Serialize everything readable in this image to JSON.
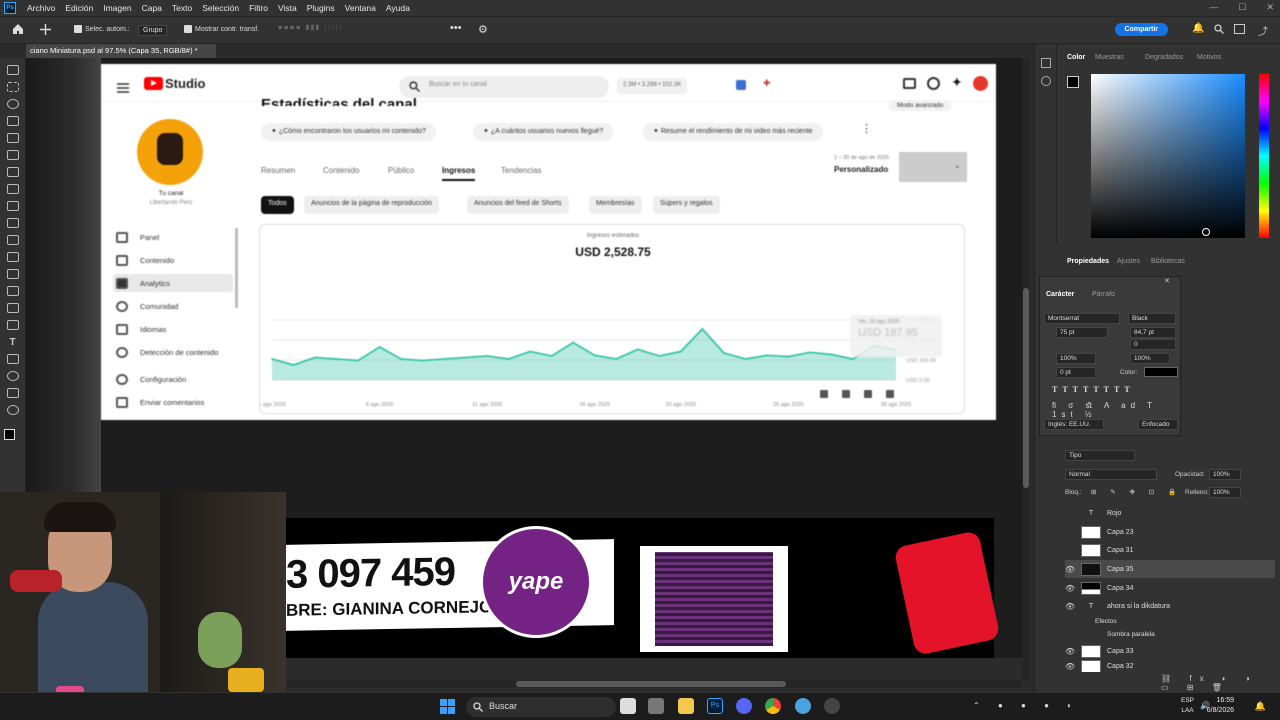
{
  "menu": [
    "Archivo",
    "Edición",
    "Imagen",
    "Capa",
    "Texto",
    "Selección",
    "Filtro",
    "Vista",
    "Plugins",
    "Ventana",
    "Ayuda"
  ],
  "options": {
    "auto_select": "Selec. autom.:",
    "group": "Grupo",
    "show_transform": "Mostrar contr. transf.",
    "share": "Compartir"
  },
  "document_tab": "ciano Miniatura.psd al 97.5% (Capa 35, RGB/8#) *",
  "yt": {
    "logo": "Studio",
    "search_placeholder": "Buscar en tu canal",
    "header_stats": "2.3M • 3.268 • 102.3K",
    "page_title": "Estadísticas del canal",
    "advanced_mode": "Modo avanzado",
    "channel_name": "Tu canal",
    "channel_handle": "Libertando Perú",
    "questions": [
      "¿Cómo encontraron los usuarios mi contenido?",
      "¿A cuántos usuarios nuevos llegué?",
      "Resume el rendimiento de mi video más reciente"
    ],
    "sidebar": [
      "Panel",
      "Contenido",
      "Analytics",
      "Comunidad",
      "Idiomas",
      "Detección de contenido",
      "Configuración",
      "Enviar comentarios"
    ],
    "tabs": [
      "Resumen",
      "Contenido",
      "Público",
      "Ingresos",
      "Tendencias"
    ],
    "date_range": "1 – 30 de ago de 2025",
    "date_mode": "Personalizado",
    "chips": [
      "Todos",
      "Anuncios de la página de reproducción",
      "Anuncios del feed de Shorts",
      "Membresías",
      "Súpers y regalos"
    ],
    "chart_caption": "Ingresos estimados",
    "chart_total": "USD 2,528.75",
    "tooltip_date": "Vie, 29 ago 2025",
    "tooltip_value": "USD 187.95",
    "chart_data": {
      "type": "area",
      "title": "Ingresos estimados",
      "x": [
        "1",
        "2",
        "3",
        "4",
        "5",
        "6",
        "7",
        "8",
        "9",
        "10",
        "11",
        "12",
        "13",
        "14",
        "15",
        "16",
        "17",
        "18",
        "19",
        "20",
        "21",
        "22",
        "23",
        "24",
        "25",
        "26",
        "27",
        "28",
        "29",
        "30"
      ],
      "x_tick_labels": [
        "1 ago 2025",
        "6 ago 2025",
        "11 ago 2025",
        "16 ago 2025",
        "20 ago 2025",
        "25 ago 2025",
        "30 ago 2025"
      ],
      "y": [
        70,
        50,
        75,
        70,
        65,
        110,
        70,
        65,
        70,
        75,
        80,
        70,
        95,
        80,
        125,
        82,
        70,
        102,
        80,
        95,
        170,
        90,
        70,
        82,
        78,
        92,
        85,
        70,
        115,
        100
      ],
      "y_tick_labels": [
        "USD 300.00",
        "USD 200.00",
        "USD 100.00",
        "USD 0.00"
      ],
      "ylim": [
        0,
        300
      ],
      "color": "#35c4a7",
      "grid": true
    }
  },
  "stream": {
    "number": "3 097 459",
    "name": "BRE: GIANINA CORNEJO",
    "yape": "yape"
  },
  "right_panel": {
    "color_tabs": [
      "Color",
      "Muestras",
      "Degradados",
      "Motivos"
    ],
    "props_tabs": [
      "Propiedades",
      "Ajustes",
      "Bibliotecas"
    ],
    "char_tabs": [
      "Carácter",
      "Párrafo"
    ],
    "font": "Montserrat",
    "weight": "Black",
    "size": "75 pt",
    "leading": "84,7 pt",
    "tracking": "0",
    "scale_v": "100%",
    "scale_h": "100%",
    "baseline": "0 pt",
    "color_label": "Color:",
    "language": "Inglés: EE.UU.",
    "aa": "Enfocado",
    "layers_filter": "Tipo",
    "blend": "Normal",
    "opacity_label": "Opacidad:",
    "opacity": "100%",
    "lock_label": "Bloq.:",
    "fill_label": "Relleno:",
    "fill": "100%",
    "layers": [
      "Rojo",
      "Capa 23",
      "Capa 31",
      "Capa 35",
      "Capa 34",
      "ahora si la dikdatura",
      "Efectos",
      "Sombra paralela",
      "Capa 33",
      "Capa 32"
    ]
  },
  "taskbar": {
    "search": "Buscar",
    "lang1": "ESP",
    "lang2": "LAA",
    "time": "16:59",
    "date": "6/8/2026"
  }
}
